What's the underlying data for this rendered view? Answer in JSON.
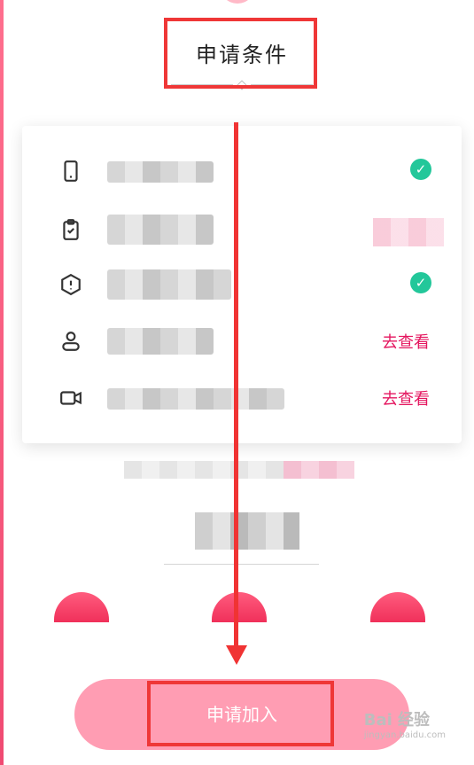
{
  "section": {
    "title": "申请条件"
  },
  "conditions": [
    {
      "icon": "phone-icon",
      "status": "done"
    },
    {
      "icon": "clipboard-check-icon",
      "status": "blurred"
    },
    {
      "icon": "alert-shield-icon",
      "status": "done"
    },
    {
      "icon": "user-icon",
      "status": "link",
      "link_label": "去查看"
    },
    {
      "icon": "video-camera-icon",
      "status": "link",
      "link_label": "去查看"
    }
  ],
  "actions": {
    "apply_label": "申请加入"
  },
  "colors": {
    "accent": "#e4165f",
    "check": "#23c79a",
    "button": "#ff9db3",
    "annotation": "#f03333"
  },
  "watermark": {
    "logo": "Bai 经验",
    "sub": "jingyan.baidu.com"
  }
}
